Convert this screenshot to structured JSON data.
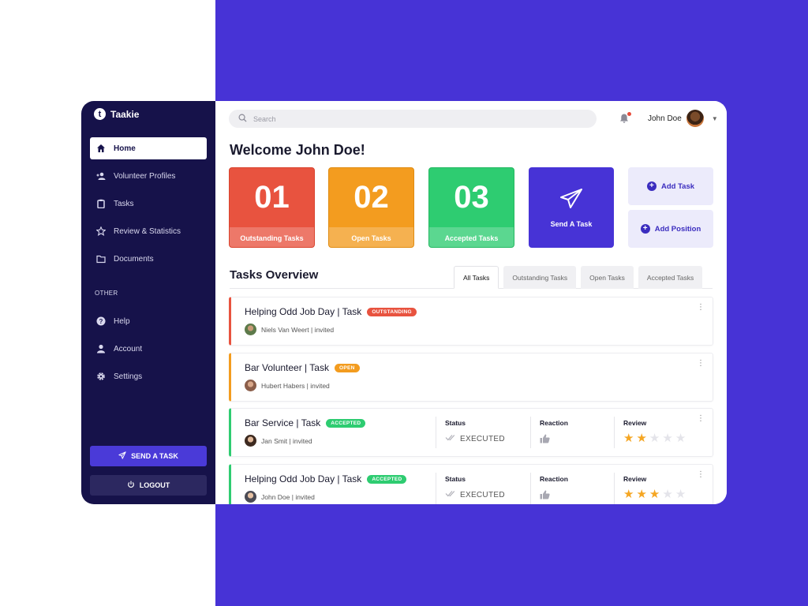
{
  "brand": {
    "logo_letter": "t",
    "name": "Taakie"
  },
  "sidebar": {
    "items": [
      {
        "label": "Home",
        "icon": "home-icon"
      },
      {
        "label": "Volunteer Profiles",
        "icon": "person-add-icon"
      },
      {
        "label": "Tasks",
        "icon": "clipboard-icon"
      },
      {
        "label": "Review & Statistics",
        "icon": "star-icon"
      },
      {
        "label": "Documents",
        "icon": "folder-icon"
      }
    ],
    "section_other": "OTHER",
    "other_items": [
      {
        "label": "Help",
        "icon": "help-icon"
      },
      {
        "label": "Account",
        "icon": "person-icon"
      },
      {
        "label": "Settings",
        "icon": "gear-icon"
      }
    ],
    "send_task": "SEND A TASK",
    "logout": "LOGOUT"
  },
  "header": {
    "search_placeholder": "Search",
    "user_name": "John Doe"
  },
  "welcome": "Welcome John Doe!",
  "stats": [
    {
      "number": "01",
      "label": "Outstanding Tasks",
      "color": "#e8533f"
    },
    {
      "number": "02",
      "label": "Open Tasks",
      "color": "#f39c1f"
    },
    {
      "number": "03",
      "label": "Accepted Tasks",
      "color": "#2ecc71"
    }
  ],
  "send_card_label": "Send A Task",
  "actions": {
    "add_task": "Add Task",
    "add_position": "Add Position"
  },
  "overview": {
    "title": "Tasks Overview",
    "tabs": [
      "All Tasks",
      "Outstanding Tasks",
      "Open Tasks",
      "Accepted Tasks"
    ]
  },
  "columns": {
    "status": "Status",
    "reaction": "Reaction",
    "review": "Review"
  },
  "tasks": [
    {
      "title": "Helping Odd Job Day | Task",
      "badge": "OUTSTANDING",
      "color": "#e8533f",
      "person": "Niels Van Weert | invited"
    },
    {
      "title": "Bar Volunteer | Task",
      "badge": "OPEN",
      "color": "#f39c1f",
      "person": "Hubert Habers | invited"
    },
    {
      "title": "Bar Service | Task",
      "badge": "ACCEPTED",
      "color": "#2ecc71",
      "person": "Jan Smit | invited",
      "status": "EXECUTED",
      "rating": 2
    },
    {
      "title": "Helping Odd Job Day | Task",
      "badge": "ACCEPTED",
      "color": "#2ecc71",
      "person": "John Doe | invited",
      "status": "EXECUTED",
      "rating": 3
    }
  ],
  "colors": {
    "accent": "#4733d6",
    "sidebar": "#16124a",
    "star": "#f5a623"
  }
}
